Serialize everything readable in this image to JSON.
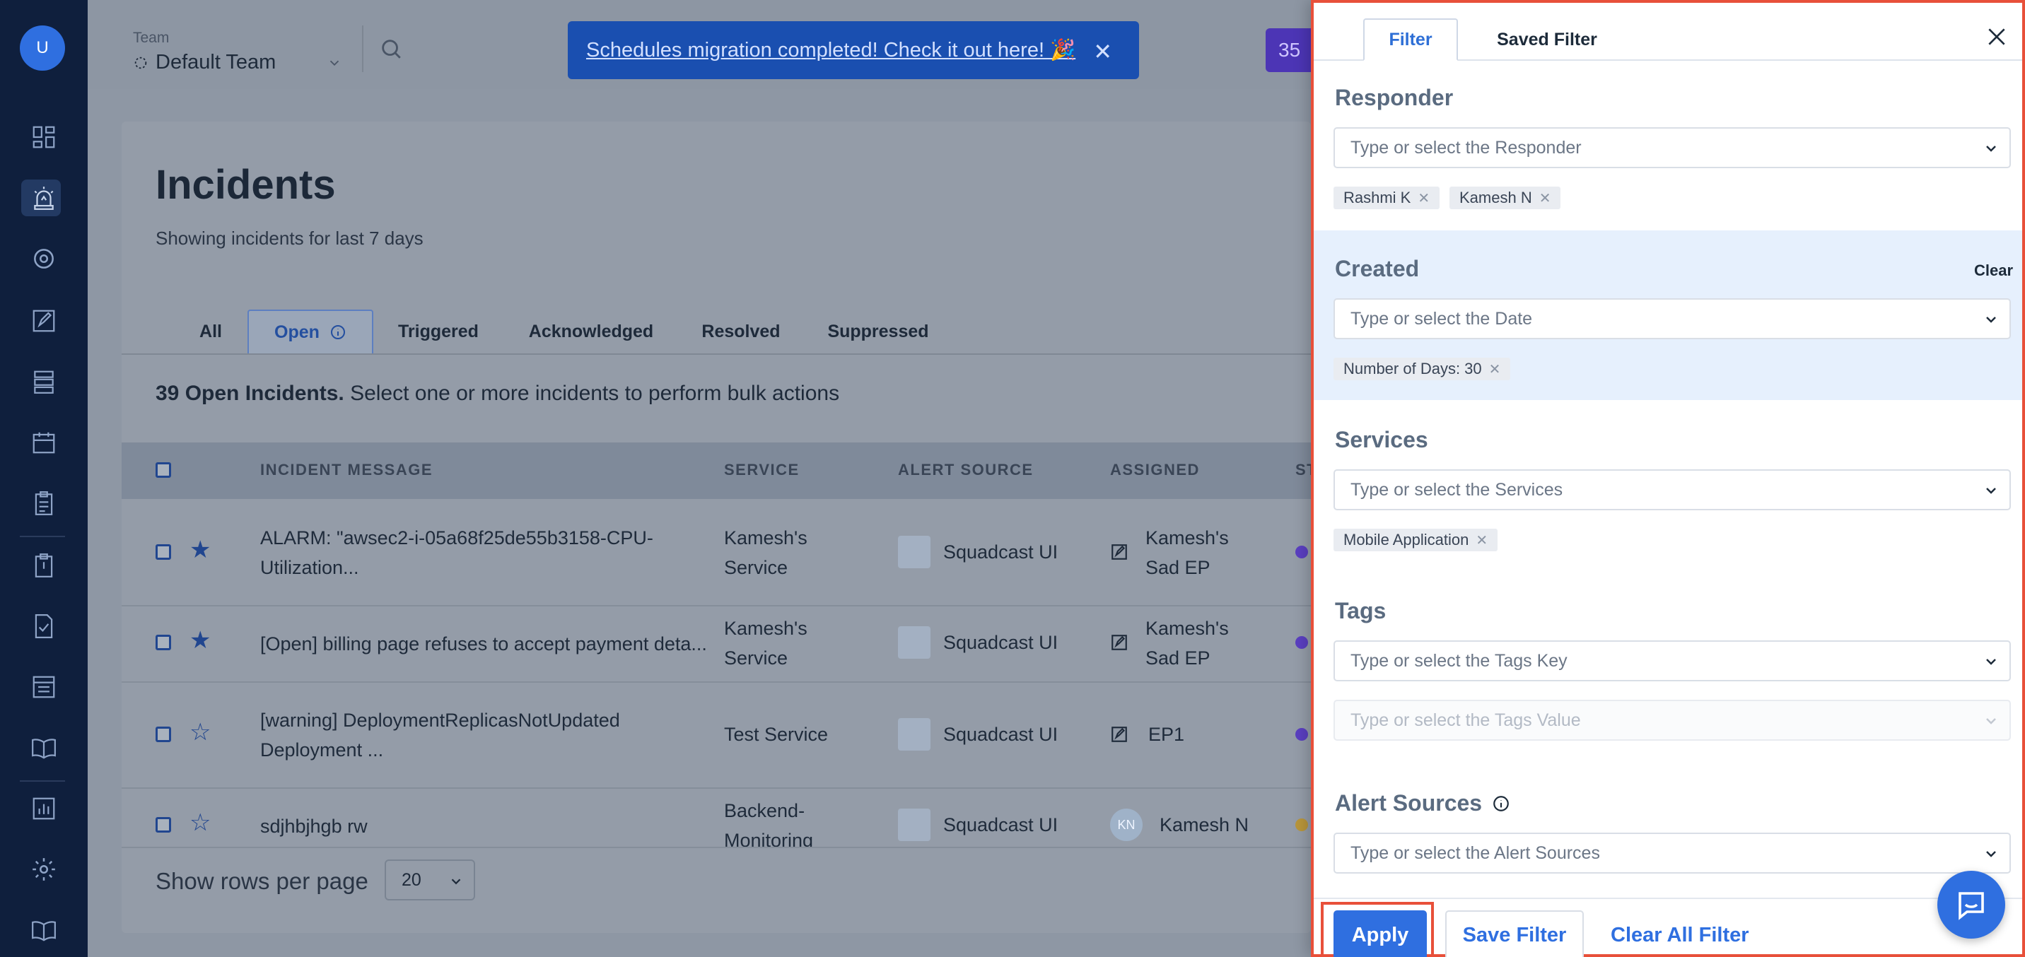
{
  "user": {
    "initial": "U"
  },
  "sidebar": {
    "items": [
      {
        "icon": "dashboard-icon"
      },
      {
        "icon": "incidents-siren-icon",
        "active": true
      },
      {
        "icon": "target-icon"
      },
      {
        "icon": "postmortem-edit-icon"
      },
      {
        "icon": "services-stack-icon"
      },
      {
        "icon": "calendar-icon"
      },
      {
        "icon": "clipboard-icon"
      },
      {
        "icon": "runbook-clipboard-icon"
      },
      {
        "icon": "document-check-icon"
      },
      {
        "icon": "status-page-icon"
      },
      {
        "icon": "book-open-icon"
      },
      {
        "icon": "analytics-chart-icon"
      },
      {
        "icon": "settings-gear-icon"
      },
      {
        "icon": "help-book-icon"
      }
    ]
  },
  "header": {
    "team_label": "Team",
    "team_name": "Default Team",
    "banner_text": "Schedules migration completed! Check it out here! 🎉",
    "badge_count": "35"
  },
  "page": {
    "title": "Incidents",
    "subtitle": "Showing incidents for last 7 days",
    "tabs": [
      {
        "label": "All"
      },
      {
        "label": "Open",
        "active": true
      },
      {
        "label": "Triggered"
      },
      {
        "label": "Acknowledged"
      },
      {
        "label": "Resolved"
      },
      {
        "label": "Suppressed"
      }
    ],
    "summary_bold": "39 Open Incidents.",
    "summary_rest": " Select one or more incidents to perform bulk actions",
    "columns": [
      "INCIDENT MESSAGE",
      "SERVICE",
      "ALERT SOURCE",
      "ASSIGNED",
      "ST"
    ],
    "rows": [
      {
        "message": "ALARM: \"awsec2-i-05a68f25de55b3158-CPU-Utilization...",
        "service": "Kamesh's Service",
        "source": "Squadcast UI",
        "assigned": "Kamesh's Sad EP",
        "starred": true,
        "status_color": "#5a3fc0"
      },
      {
        "message": "[Open] billing page refuses to accept payment deta...",
        "service": "Kamesh's Service",
        "source": "Squadcast UI",
        "assigned": "Kamesh's Sad EP",
        "starred": true,
        "status_color": "#5a3fc0"
      },
      {
        "message": "[warning] DeploymentReplicasNotUpdated Deployment ...",
        "service": "Test Service",
        "source": "Squadcast UI",
        "assigned": "EP1",
        "starred": false,
        "status_color": "#5a3fc0"
      },
      {
        "message": "sdjhbjhgb rw",
        "service": "Backend-Monitoring -...",
        "source": "Squadcast UI",
        "assigned": "Kamesh N",
        "assigned_initials": "KN",
        "starred": false,
        "status_color": "#b8953a"
      }
    ],
    "rows_per_page_label": "Show rows per page",
    "rows_per_page_value": "20"
  },
  "filter_panel": {
    "tabs": [
      "Filter",
      "Saved Filter"
    ],
    "responder": {
      "title": "Responder",
      "placeholder": "Type or select the Responder",
      "chips": [
        "Rashmi K",
        "Kamesh N"
      ]
    },
    "created": {
      "title": "Created",
      "clear_label": "Clear",
      "placeholder": "Type or select the Date",
      "chips": [
        "Number of Days: 30"
      ]
    },
    "services": {
      "title": "Services",
      "placeholder": "Type or select the Services",
      "chips": [
        "Mobile Application"
      ]
    },
    "tags": {
      "title": "Tags",
      "key_placeholder": "Type or select the Tags Key",
      "value_placeholder": "Type or select the Tags Value"
    },
    "alert_sources": {
      "title": "Alert Sources",
      "placeholder": "Type or select the Alert Sources"
    },
    "buttons": {
      "apply": "Apply",
      "save": "Save Filter",
      "clear_all": "Clear All Filter"
    }
  },
  "colors": {
    "sidebar_bg": "#0f1f3d",
    "accent": "#2f6fe0",
    "highlight_outline": "#e8503a",
    "section_highlight": "#e6f0fd"
  }
}
